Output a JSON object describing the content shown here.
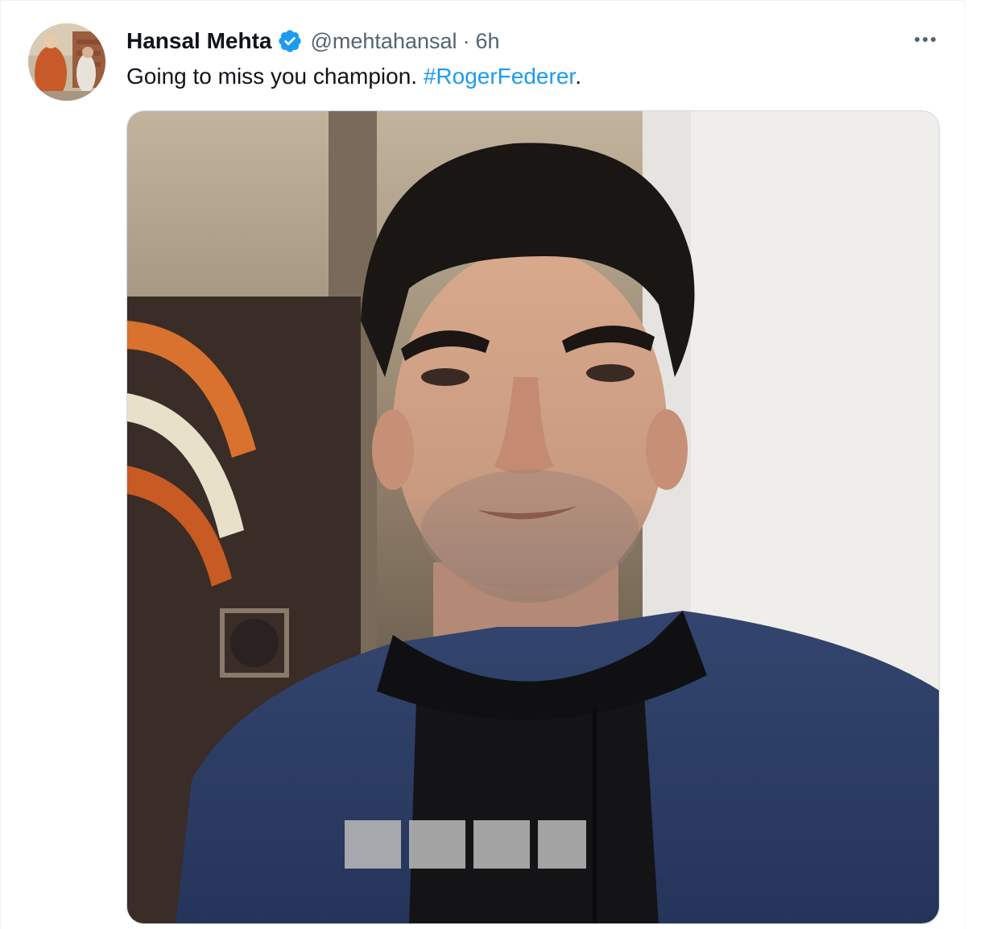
{
  "tweet": {
    "author": {
      "display_name": "Hansal Mehta",
      "handle": "@mehtahansal",
      "verified": true,
      "avatar_icon": "profile-photo"
    },
    "separator": "·",
    "timestamp": "6h",
    "text_prefix": "Going to miss you champion. ",
    "hashtag": "#RogerFederer",
    "text_suffix": ".",
    "more_icon": "more-horizontal-icon",
    "media": {
      "type": "photo",
      "icon": "photo-of-man-in-navy-jacket"
    }
  },
  "colors": {
    "text_primary": "#0f1419",
    "text_secondary": "#536471",
    "link": "#1d9bf0",
    "verified_badge": "#1d9bf0",
    "border": "#cfd9de"
  }
}
